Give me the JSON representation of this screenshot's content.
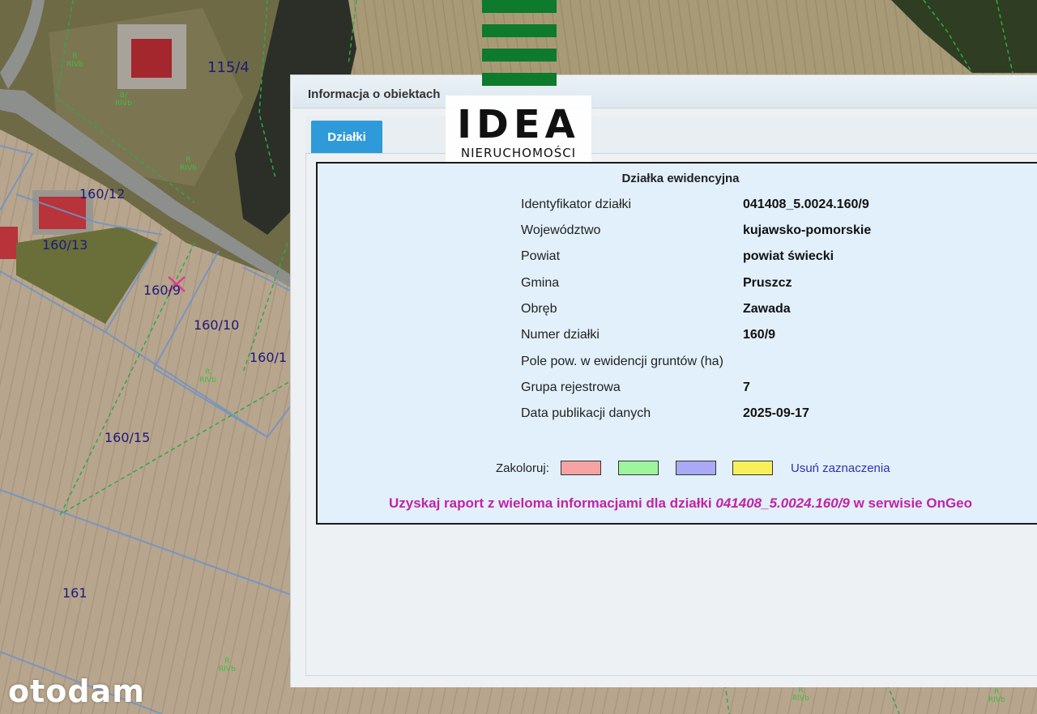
{
  "map": {
    "parcel_labels": [
      "115/4",
      "160/12",
      "160/13",
      "160/9",
      "160/10",
      "160/1",
      "160/15",
      "161"
    ],
    "use_codes": [
      "R\nRIVb",
      "B/\nRIVb",
      "R\nRIVb",
      "R\nRIVb",
      "R\nRIVb",
      "R\nRIVb",
      "R\nRIVb"
    ]
  },
  "logo": {
    "main": "IDEA",
    "sub": "NIERUCHOMOŚCI",
    "color": "#0d7a2c"
  },
  "panel": {
    "title": "Informacja o obiektach",
    "tab": "Działki"
  },
  "parcel_info": {
    "heading": "Działka ewidencyjna",
    "rows": [
      {
        "label": "Identyfikator działki",
        "value": "041408_5.0024.160/9"
      },
      {
        "label": "Województwo",
        "value": "kujawsko-pomorskie"
      },
      {
        "label": "Powiat",
        "value": "powiat świecki"
      },
      {
        "label": "Gmina",
        "value": "Pruszcz"
      },
      {
        "label": "Obręb",
        "value": "Zawada"
      },
      {
        "label": "Numer działki",
        "value": "160/9"
      },
      {
        "label": "Pole pow. w ewidencji gruntów (ha)",
        "value": ""
      },
      {
        "label": "Grupa rejestrowa",
        "value": "7"
      },
      {
        "label": "Data publikacji danych",
        "value": "2025-09-17"
      }
    ]
  },
  "colorize": {
    "label": "Zakoloruj:",
    "swatches": [
      "#f7a3a3",
      "#9ef59e",
      "#a9a9f5",
      "#f7f05a"
    ],
    "clear_link": "Usuń zaznaczenia"
  },
  "report": {
    "prefix": "Uzyskaj raport z wieloma informacjami dla działki",
    "id": "041408_5.0024.160/9",
    "suffix": "w serwisie OnGeo",
    "color": "#c223a6"
  },
  "watermark": "otodam"
}
